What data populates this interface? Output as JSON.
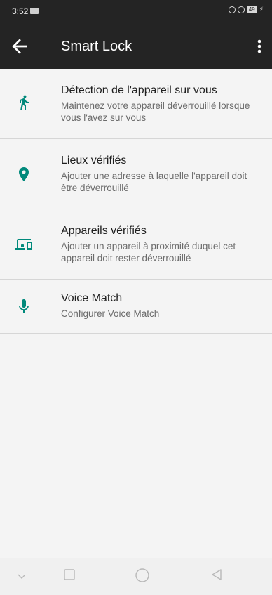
{
  "status_bar": {
    "time": "3:52",
    "battery": "49"
  },
  "app_bar": {
    "title": "Smart Lock"
  },
  "colors": {
    "accent": "#00897b",
    "app_bar": "#242424",
    "background": "#f4f4f4"
  },
  "items": [
    {
      "icon": "walking-person-icon",
      "title": "Détection de l'appareil sur vous",
      "subtitle": "Maintenez votre appareil déverrouillé lorsque vous l'avez sur vous"
    },
    {
      "icon": "location-pin-icon",
      "title": "Lieux vérifiés",
      "subtitle": "Ajouter une adresse à laquelle l'appareil doit être déverrouillé"
    },
    {
      "icon": "devices-icon",
      "title": "Appareils vérifiés",
      "subtitle": "Ajouter un appareil à proximité duquel cet appareil doit rester déverrouillé"
    },
    {
      "icon": "microphone-icon",
      "title": "Voice Match",
      "subtitle": "Configurer Voice Match"
    }
  ]
}
